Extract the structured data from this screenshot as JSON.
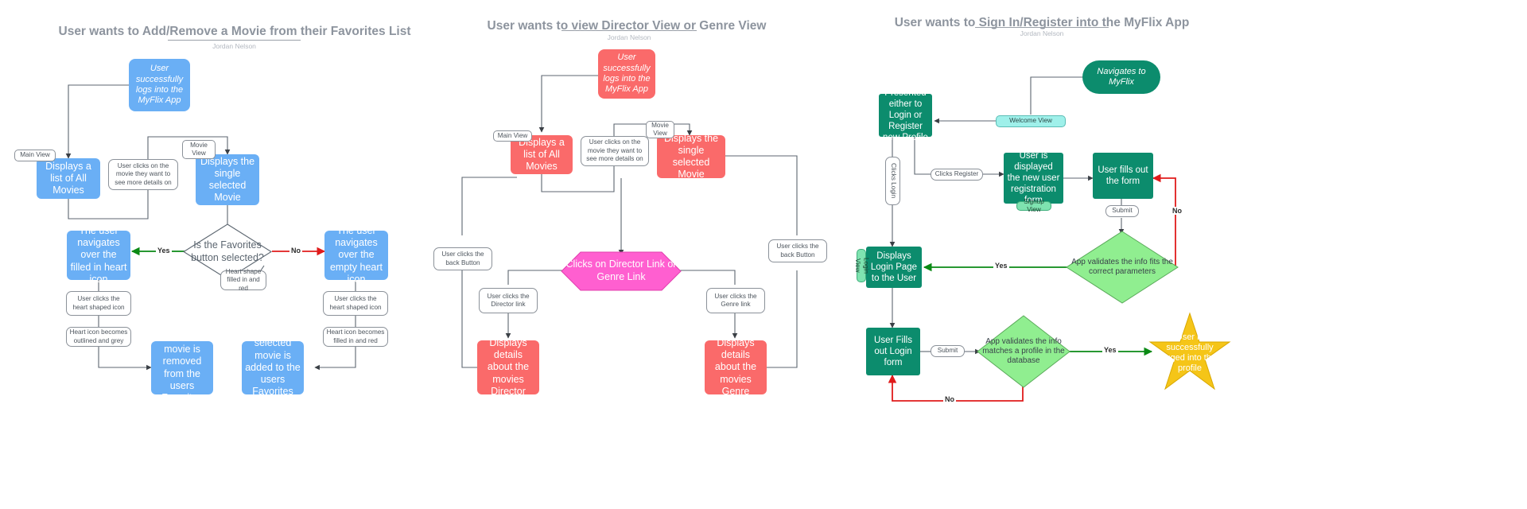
{
  "panels": [
    {
      "id": "favorites",
      "title": "User wants to Add/Remove a Movie from their Favorites List",
      "author": "Jordan Nelson",
      "nodes": {
        "start": "User successfully logs into the MyFlix App",
        "all_movies": "Displays a list of All Movies",
        "single_movie": "Displays the single selected Movie",
        "decision": "Is the Favorites button selected?",
        "nav_filled": "The user navigates over the filled in heart icon",
        "nav_empty": "The user navigates over the empty heart icon",
        "removed": "The selected movie is removed from the users Favorites List",
        "added": "The selected movie is added to the users Favorites List"
      },
      "tags": {
        "main_view": "Main View",
        "movie_view": "Movie View"
      },
      "notes": {
        "click_movie": "User clicks on the movie they want to see more details on",
        "heart_filled_red": "Heart shape filled in and red",
        "click_heart_left": "User clicks the heart shaped icon",
        "click_heart_right": "User clicks the heart shaped icon",
        "becomes_outlined": "Heart icon becomes outlined and grey",
        "becomes_filled": "Heart icon becomes filled in and red"
      },
      "edge_labels": {
        "yes": "Yes",
        "no": "No"
      }
    },
    {
      "id": "director-genre",
      "title": "User wants to view Director View or Genre View",
      "author": "Jordan Nelson",
      "nodes": {
        "start": "User successfully logs into the MyFlix App",
        "all_movies": "Displays a list of All Movies",
        "single_movie": "Displays the single selected Movie",
        "clicks_link": "Clicks on Director Link or Genre Link",
        "director_details": "Displays details about the movies Director",
        "genre_details": "Displays details about the movies Genre"
      },
      "tags": {
        "main_view": "Main View",
        "movie_view": "Movie View"
      },
      "notes": {
        "click_movie": "User clicks on the movie they want to see more details on",
        "back_left": "User clicks the back Button",
        "back_right": "User clicks the back Button",
        "director_link": "User clicks the Director link",
        "genre_link": "User clicks the Genre link"
      }
    },
    {
      "id": "signin-register",
      "title": "User wants to Sign In/Register into the MyFlix App",
      "author": "Jordan Nelson",
      "nodes": {
        "navigates": "Navigates to MyFlix",
        "presented": "Presented either to Login or Register new Profile",
        "registration": "User is displayed the new user registration form",
        "fills_form": "User fills out the form",
        "validates_params": "App validates the info fits the correct parameters",
        "login_page": "Displays Login Page to the User",
        "fills_login": "User Fills out Login form",
        "validates_profile": "App validates the info matches a profile in the database",
        "success": "User is successfully logged into their profile"
      },
      "tags": {
        "welcome_view": "Welcome View",
        "signup_view": "Signup View",
        "login_view": "Login View"
      },
      "notes": {
        "clicks_login": "Clicks Login",
        "clicks_register": "Clicks Register",
        "submit_top": "Submit",
        "submit_bottom": "Submit"
      },
      "edge_labels": {
        "yes_top": "Yes",
        "no_top": "No",
        "yes_bottom": "Yes",
        "no_bottom": "No"
      }
    }
  ],
  "colors": {
    "blue": "#6aaff5",
    "red": "#fa6a6a",
    "green": "#0c8c6d",
    "light_green": "#90ee90",
    "pink": "#ff5fd0",
    "gold": "#f5c518",
    "yes": "#0a8a14",
    "no": "#e01b1b",
    "wire": "#5c6670",
    "title": "#8d949e"
  }
}
